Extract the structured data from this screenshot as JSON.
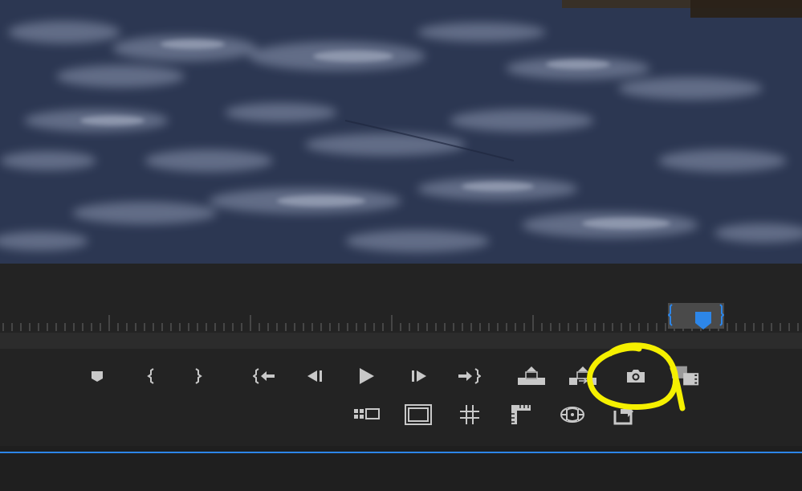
{
  "colors": {
    "panel_bg": "#232323",
    "icon": "#c8c8c8",
    "accent_blue": "#2d86e8",
    "annotation": "#f5f000",
    "asphalt": "#2b3650"
  },
  "video": {
    "content": "asphalt-with-tree-shadows"
  },
  "transport_row1": [
    {
      "name": "add-marker-button",
      "icon": "marker-icon"
    },
    {
      "name": "mark-in-button",
      "icon": "mark-in-icon"
    },
    {
      "name": "mark-out-button",
      "icon": "mark-out-icon"
    },
    {
      "name": "go-to-in-button",
      "icon": "go-to-in-icon"
    },
    {
      "name": "step-back-button",
      "icon": "step-back-icon"
    },
    {
      "name": "play-button",
      "icon": "play-icon"
    },
    {
      "name": "step-forward-button",
      "icon": "step-forward-icon"
    },
    {
      "name": "go-to-out-button",
      "icon": "go-to-out-icon"
    },
    {
      "name": "lift-button",
      "icon": "lift-icon"
    },
    {
      "name": "extract-button",
      "icon": "extract-icon"
    },
    {
      "name": "export-frame-button",
      "icon": "camera-icon"
    },
    {
      "name": "comparison-view-button",
      "icon": "film-compare-icon"
    }
  ],
  "transport_row2": [
    {
      "name": "multi-camera-button",
      "icon": "multicam-icon"
    },
    {
      "name": "safe-margins-button",
      "icon": "safe-margins-icon"
    },
    {
      "name": "guides-button",
      "icon": "grid-icon"
    },
    {
      "name": "rulers-button",
      "icon": "ruler-icon"
    },
    {
      "name": "vr-video-button",
      "icon": "vr-icon"
    },
    {
      "name": "export-button",
      "icon": "export-icon"
    }
  ],
  "annotation": {
    "shape": "hand-drawn-circle",
    "target": "export-frame-button"
  }
}
